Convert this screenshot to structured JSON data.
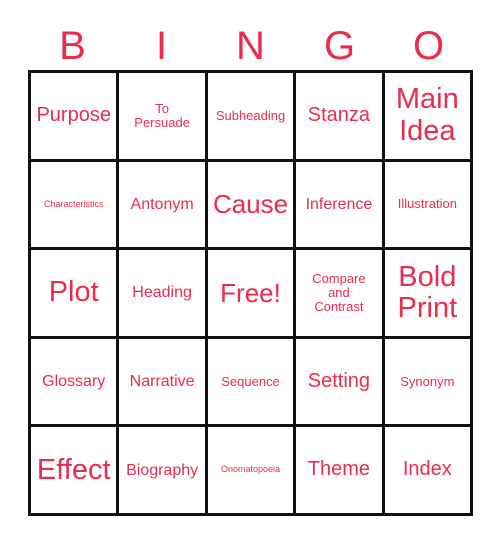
{
  "card": {
    "title": "BINGO",
    "accent_color": "#ea2c4e",
    "border_color": "#111111",
    "background_color": "#ffffff"
  },
  "header": {
    "letters": [
      {
        "label": "B"
      },
      {
        "label": "I"
      },
      {
        "label": "N"
      },
      {
        "label": "G"
      },
      {
        "label": "O"
      }
    ]
  },
  "grid": {
    "columns": 5,
    "rows": 5,
    "free_space": {
      "row": 2,
      "column": 2,
      "label": "Free!"
    },
    "cells": [
      [
        {
          "label": "Purpose",
          "size": "l",
          "free": false
        },
        {
          "label": "To\nPersuade",
          "size": "s",
          "free": false
        },
        {
          "label": "Subheading",
          "size": "s",
          "free": false
        },
        {
          "label": "Stanza",
          "size": "l",
          "free": false
        },
        {
          "label": "Main\nIdea",
          "size": "xxl",
          "free": false
        }
      ],
      [
        {
          "label": "Characteristics",
          "size": "xxs",
          "free": false
        },
        {
          "label": "Antonym",
          "size": "m",
          "free": false
        },
        {
          "label": "Cause",
          "size": "xl",
          "free": false
        },
        {
          "label": "Inference",
          "size": "m",
          "free": false
        },
        {
          "label": "Illustration",
          "size": "s",
          "free": false
        }
      ],
      [
        {
          "label": "Plot",
          "size": "xxl",
          "free": false
        },
        {
          "label": "Heading",
          "size": "m",
          "free": false
        },
        {
          "label": "Free!",
          "size": "xl",
          "free": true
        },
        {
          "label": "Compare\nand\nContrast",
          "size": "s",
          "free": false
        },
        {
          "label": "Bold\nPrint",
          "size": "xxl",
          "free": false
        }
      ],
      [
        {
          "label": "Glossary",
          "size": "m",
          "free": false
        },
        {
          "label": "Narrative",
          "size": "m",
          "free": false
        },
        {
          "label": "Sequence",
          "size": "s",
          "free": false
        },
        {
          "label": "Setting",
          "size": "l",
          "free": false
        },
        {
          "label": "Synonym",
          "size": "s",
          "free": false
        }
      ],
      [
        {
          "label": "Effect",
          "size": "xxl",
          "free": false
        },
        {
          "label": "Biography",
          "size": "m",
          "free": false
        },
        {
          "label": "Onomatopoeia",
          "size": "xxs",
          "free": false
        },
        {
          "label": "Theme",
          "size": "l",
          "free": false
        },
        {
          "label": "Index",
          "size": "l",
          "free": false
        }
      ]
    ]
  }
}
